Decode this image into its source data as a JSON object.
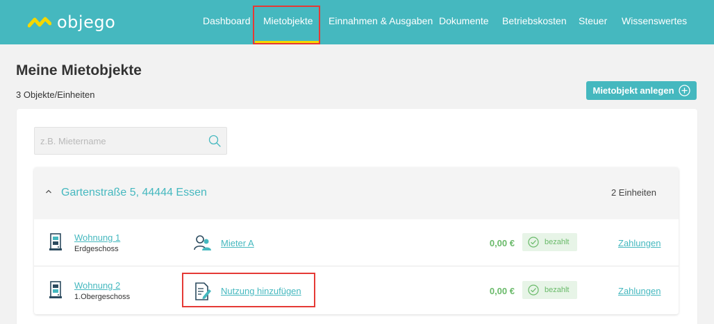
{
  "header": {
    "logo_text": "objego",
    "nav": [
      {
        "label": "Dashboard",
        "active": false
      },
      {
        "label": "Mietobjekte",
        "active": true
      },
      {
        "label": "Einnahmen & Ausgaben",
        "active": false
      },
      {
        "label": "Dokumente",
        "active": false
      },
      {
        "label": "Betriebskosten",
        "active": false
      },
      {
        "label": "Steuer",
        "active": false
      },
      {
        "label": "Wissenswertes",
        "active": false
      }
    ]
  },
  "page": {
    "title": "Meine Mietobjekte",
    "count_text": "3 Objekte/Einheiten",
    "add_button": "Mietobjekt anlegen"
  },
  "search": {
    "placeholder": "z.B. Mietername",
    "value": ""
  },
  "property": {
    "title": "Gartenstraße 5, 44444 Essen",
    "units_count": "2 Einheiten",
    "units": [
      {
        "name": "Wohnung 1",
        "floor": "Erdgeschoss",
        "tenant": "Mieter A",
        "tenant_icon": "tenant-icon",
        "amount": "0,00 €",
        "status": "bezahlt",
        "payments": "Zahlungen"
      },
      {
        "name": "Wohnung 2",
        "floor": "1.Obergeschoss",
        "tenant": "Nutzung hinzufügen",
        "tenant_icon": "add-usage-icon",
        "amount": "0,00 €",
        "status": "bezahlt",
        "payments": "Zahlungen"
      }
    ]
  },
  "colors": {
    "brand": "#45b8bf",
    "accent": "#f5d800",
    "paid": "#6aba6a",
    "highlight": "#e53935"
  }
}
